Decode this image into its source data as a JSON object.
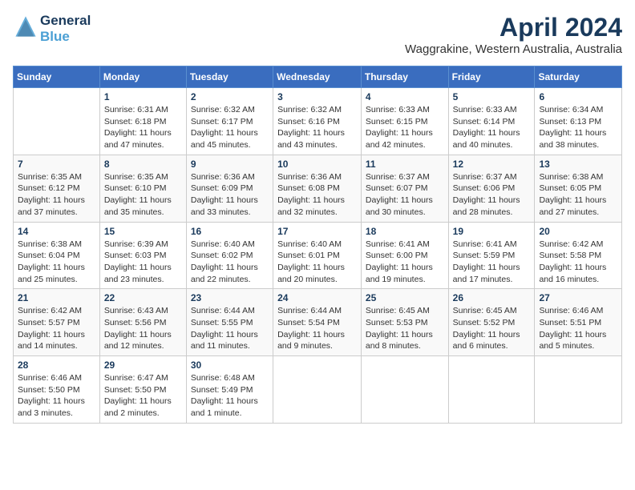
{
  "header": {
    "logo_line1": "General",
    "logo_line2": "Blue",
    "month": "April 2024",
    "location": "Waggrakine, Western Australia, Australia"
  },
  "days_of_week": [
    "Sunday",
    "Monday",
    "Tuesday",
    "Wednesday",
    "Thursday",
    "Friday",
    "Saturday"
  ],
  "weeks": [
    [
      {
        "day": "",
        "info": ""
      },
      {
        "day": "1",
        "info": "Sunrise: 6:31 AM\nSunset: 6:18 PM\nDaylight: 11 hours\nand 47 minutes."
      },
      {
        "day": "2",
        "info": "Sunrise: 6:32 AM\nSunset: 6:17 PM\nDaylight: 11 hours\nand 45 minutes."
      },
      {
        "day": "3",
        "info": "Sunrise: 6:32 AM\nSunset: 6:16 PM\nDaylight: 11 hours\nand 43 minutes."
      },
      {
        "day": "4",
        "info": "Sunrise: 6:33 AM\nSunset: 6:15 PM\nDaylight: 11 hours\nand 42 minutes."
      },
      {
        "day": "5",
        "info": "Sunrise: 6:33 AM\nSunset: 6:14 PM\nDaylight: 11 hours\nand 40 minutes."
      },
      {
        "day": "6",
        "info": "Sunrise: 6:34 AM\nSunset: 6:13 PM\nDaylight: 11 hours\nand 38 minutes."
      }
    ],
    [
      {
        "day": "7",
        "info": "Sunrise: 6:35 AM\nSunset: 6:12 PM\nDaylight: 11 hours\nand 37 minutes."
      },
      {
        "day": "8",
        "info": "Sunrise: 6:35 AM\nSunset: 6:10 PM\nDaylight: 11 hours\nand 35 minutes."
      },
      {
        "day": "9",
        "info": "Sunrise: 6:36 AM\nSunset: 6:09 PM\nDaylight: 11 hours\nand 33 minutes."
      },
      {
        "day": "10",
        "info": "Sunrise: 6:36 AM\nSunset: 6:08 PM\nDaylight: 11 hours\nand 32 minutes."
      },
      {
        "day": "11",
        "info": "Sunrise: 6:37 AM\nSunset: 6:07 PM\nDaylight: 11 hours\nand 30 minutes."
      },
      {
        "day": "12",
        "info": "Sunrise: 6:37 AM\nSunset: 6:06 PM\nDaylight: 11 hours\nand 28 minutes."
      },
      {
        "day": "13",
        "info": "Sunrise: 6:38 AM\nSunset: 6:05 PM\nDaylight: 11 hours\nand 27 minutes."
      }
    ],
    [
      {
        "day": "14",
        "info": "Sunrise: 6:38 AM\nSunset: 6:04 PM\nDaylight: 11 hours\nand 25 minutes."
      },
      {
        "day": "15",
        "info": "Sunrise: 6:39 AM\nSunset: 6:03 PM\nDaylight: 11 hours\nand 23 minutes."
      },
      {
        "day": "16",
        "info": "Sunrise: 6:40 AM\nSunset: 6:02 PM\nDaylight: 11 hours\nand 22 minutes."
      },
      {
        "day": "17",
        "info": "Sunrise: 6:40 AM\nSunset: 6:01 PM\nDaylight: 11 hours\nand 20 minutes."
      },
      {
        "day": "18",
        "info": "Sunrise: 6:41 AM\nSunset: 6:00 PM\nDaylight: 11 hours\nand 19 minutes."
      },
      {
        "day": "19",
        "info": "Sunrise: 6:41 AM\nSunset: 5:59 PM\nDaylight: 11 hours\nand 17 minutes."
      },
      {
        "day": "20",
        "info": "Sunrise: 6:42 AM\nSunset: 5:58 PM\nDaylight: 11 hours\nand 16 minutes."
      }
    ],
    [
      {
        "day": "21",
        "info": "Sunrise: 6:42 AM\nSunset: 5:57 PM\nDaylight: 11 hours\nand 14 minutes."
      },
      {
        "day": "22",
        "info": "Sunrise: 6:43 AM\nSunset: 5:56 PM\nDaylight: 11 hours\nand 12 minutes."
      },
      {
        "day": "23",
        "info": "Sunrise: 6:44 AM\nSunset: 5:55 PM\nDaylight: 11 hours\nand 11 minutes."
      },
      {
        "day": "24",
        "info": "Sunrise: 6:44 AM\nSunset: 5:54 PM\nDaylight: 11 hours\nand 9 minutes."
      },
      {
        "day": "25",
        "info": "Sunrise: 6:45 AM\nSunset: 5:53 PM\nDaylight: 11 hours\nand 8 minutes."
      },
      {
        "day": "26",
        "info": "Sunrise: 6:45 AM\nSunset: 5:52 PM\nDaylight: 11 hours\nand 6 minutes."
      },
      {
        "day": "27",
        "info": "Sunrise: 6:46 AM\nSunset: 5:51 PM\nDaylight: 11 hours\nand 5 minutes."
      }
    ],
    [
      {
        "day": "28",
        "info": "Sunrise: 6:46 AM\nSunset: 5:50 PM\nDaylight: 11 hours\nand 3 minutes."
      },
      {
        "day": "29",
        "info": "Sunrise: 6:47 AM\nSunset: 5:50 PM\nDaylight: 11 hours\nand 2 minutes."
      },
      {
        "day": "30",
        "info": "Sunrise: 6:48 AM\nSunset: 5:49 PM\nDaylight: 11 hours\nand 1 minute."
      },
      {
        "day": "",
        "info": ""
      },
      {
        "day": "",
        "info": ""
      },
      {
        "day": "",
        "info": ""
      },
      {
        "day": "",
        "info": ""
      }
    ]
  ]
}
